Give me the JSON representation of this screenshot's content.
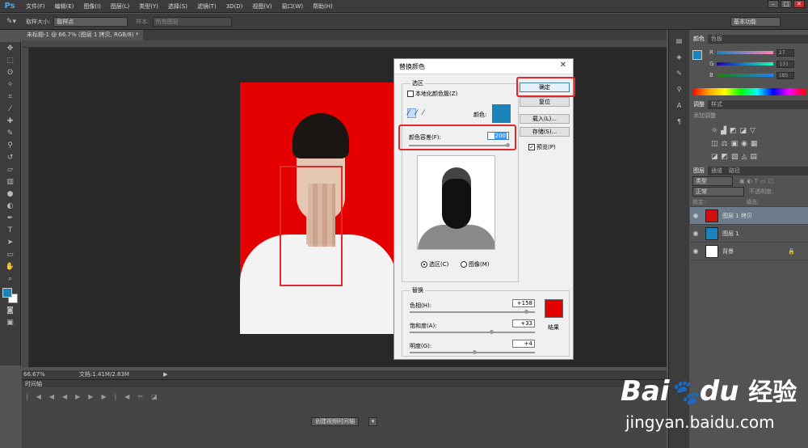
{
  "app": {
    "logo": "Ps",
    "win_min": "–",
    "win_max": "□",
    "win_close": "✕"
  },
  "menu": [
    "文件(F)",
    "编辑(E)",
    "图像(I)",
    "图层(L)",
    "类型(Y)",
    "选择(S)",
    "滤镜(T)",
    "3D(D)",
    "视图(V)",
    "窗口(W)",
    "帮助(H)"
  ],
  "options_bar": {
    "sample_size_label": "取样大小:",
    "sample_size_value": "取样点",
    "sample_label": "样本:",
    "sample_value": "所有图层",
    "workspace": "基本功能"
  },
  "document": {
    "tab_title": "未标题-1 @ 66.7% (图层 1 拷贝, RGB/8) *",
    "zoom": "66.67%",
    "doc_info": "文档:1.41M/2.83M"
  },
  "timeline": {
    "title": "时间轴",
    "create_button": "创建视频时间轴"
  },
  "color_panel": {
    "tab_color": "颜色",
    "tab_swatches": "色板",
    "r_label": "R",
    "r_value": "27",
    "g_label": "G",
    "g_value": "131",
    "b_label": "B",
    "b_value": "185",
    "fg_color": "#1b83b9"
  },
  "adjust_panel": {
    "tab_adjust": "调整",
    "tab_styles": "样式",
    "hint": "添加调整"
  },
  "layers_panel": {
    "tab_layers": "图层",
    "tab_channels": "通道",
    "tab_paths": "路径",
    "kind": "类型",
    "blend": "正常",
    "opacity_label": "不透明度:",
    "lock_label": "锁定:",
    "fill_label": "填充:",
    "layers": [
      {
        "name": "图层 1 拷贝",
        "selected": true
      },
      {
        "name": "图层 1",
        "selected": false
      },
      {
        "name": "背景",
        "selected": false
      }
    ]
  },
  "dialog": {
    "title": "替换颜色",
    "ok": "确定",
    "reset": "复位",
    "load": "载入(L)...",
    "save": "存储(S)...",
    "preview": "预览(P)",
    "selection_group": "选区",
    "localized": "本地化颜色簇(Z)",
    "color_label": "颜色:",
    "fuzziness_label": "颜色容差(F):",
    "fuzziness_value": "200",
    "radio_selection": "选区(C)",
    "radio_image": "图像(M)",
    "replace_group": "替换",
    "hue_label": "色相(H):",
    "hue_value": "+158",
    "sat_label": "饱和度(A):",
    "sat_value": "+33",
    "light_label": "明度(G):",
    "light_value": "+4",
    "result_label": "结果",
    "sample_color": "#1b83b9",
    "result_color": "#e50000",
    "fuzziness_fraction": 1.0,
    "hue_fraction": 0.94,
    "sat_fraction": 0.66,
    "light_fraction": 0.52
  },
  "watermark": {
    "brand_a": "Bai",
    "brand_b": "du",
    "brand_c": "经验",
    "url": "jingyan.baidu.com"
  }
}
